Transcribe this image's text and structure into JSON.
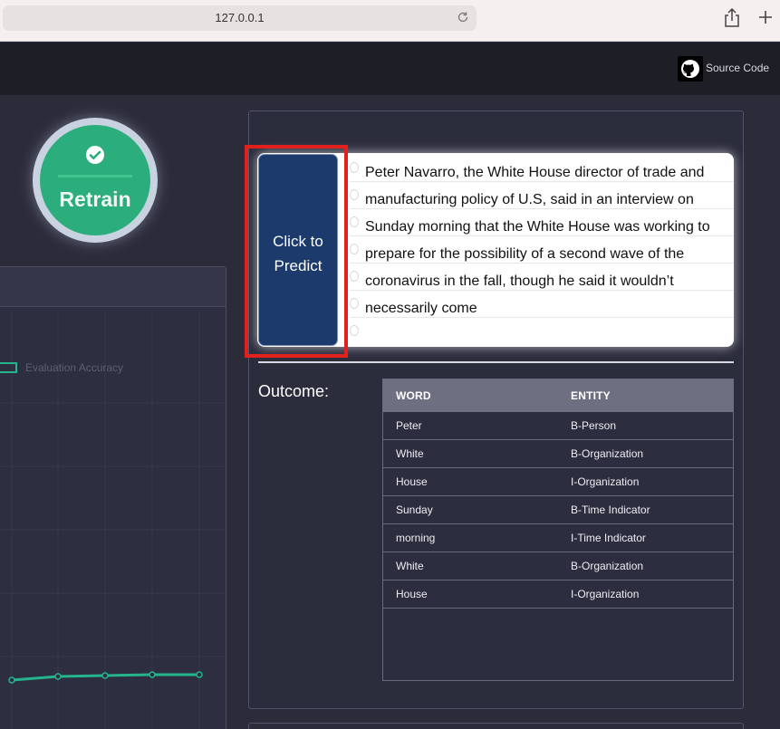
{
  "browser": {
    "url": "127.0.0.1"
  },
  "header": {
    "source_link": "Source Code",
    "github_icon": "github-icon"
  },
  "retrain": {
    "label": "Retrain",
    "icon": "check-circle-icon",
    "color": "#2cae7c"
  },
  "chart_panel": {
    "legend_label": "Evaluation Accuracy",
    "line_color": "#25b58c"
  },
  "predict_button": {
    "label_line1": "Click to",
    "label_line2": "Predict",
    "color": "#1c3a6b"
  },
  "article": {
    "text": "Peter Navarro, the White House director of trade and manufacturing policy of U.S, said in an interview on Sunday morning that the White House was working to prepare for the possibility of a second wave of the coronavirus in the fall, though he said it wouldn’t necessarily come"
  },
  "outcome": {
    "label": "Outcome:",
    "columns": [
      "WORD",
      "ENTITY"
    ],
    "rows": [
      {
        "word": "Peter",
        "entity": "B-Person"
      },
      {
        "word": "White",
        "entity": "B-Organization"
      },
      {
        "word": "House",
        "entity": "I-Organization"
      },
      {
        "word": "Sunday",
        "entity": "B-Time Indicator"
      },
      {
        "word": "morning",
        "entity": "I-Time Indicator"
      },
      {
        "word": "White",
        "entity": "B-Organization"
      },
      {
        "word": "House",
        "entity": "I-Organization"
      }
    ]
  }
}
